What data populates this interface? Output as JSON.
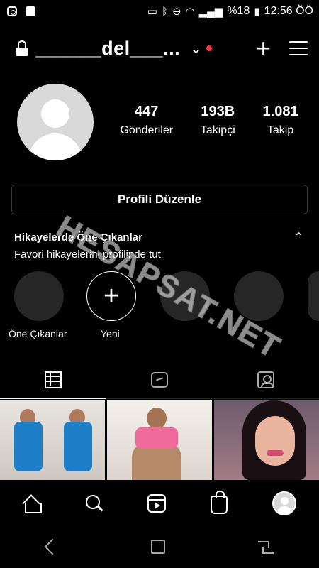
{
  "status_bar": {
    "battery": "%18",
    "time": "12:56 ÖÖ"
  },
  "header": {
    "username": "______del___...",
    "chevron": "⌄",
    "add_icon": "+",
    "menu_icon": "menu-icon"
  },
  "profile": {
    "stats": [
      {
        "value": "447",
        "label": "Gönderiler"
      },
      {
        "value": "193B",
        "label": "Takipçi"
      },
      {
        "value": "1.081",
        "label": "Takip"
      }
    ],
    "edit_button": "Profili Düzenle"
  },
  "highlights": {
    "title": "Hikayelerde Öne Çıkanlar",
    "subtitle": "Favori hikayelerini profilinde tut",
    "items": [
      {
        "label": "Öne Çıkanlar"
      },
      {
        "label": "Yeni"
      }
    ],
    "new_plus": "+"
  },
  "watermark": "HESAPSAT.NET",
  "tabs": [
    "grid",
    "igtv",
    "tagged"
  ],
  "colors": {
    "background": "#000000",
    "notification_dot": "#ff3040",
    "highlight_circle": "#262626"
  }
}
